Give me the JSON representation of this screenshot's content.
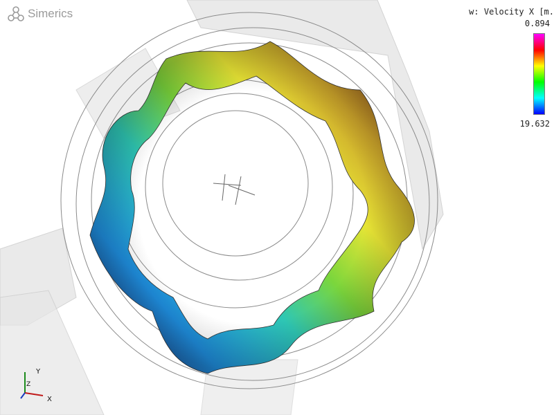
{
  "brand": {
    "name": "Simerics",
    "logo_icon": "molecule-logo-icon",
    "color": "#9a9a9a"
  },
  "legend": {
    "title": "w: Velocity X [m.",
    "max_value": "0.894",
    "min_value": "19.632",
    "colormap": [
      "#ff00ff",
      "#ff0000",
      "#ffff00",
      "#00ff00",
      "#00ffff",
      "#0000ff"
    ]
  },
  "axes": {
    "x_label": "X",
    "y_label": "Y",
    "z_label": "Z"
  }
}
